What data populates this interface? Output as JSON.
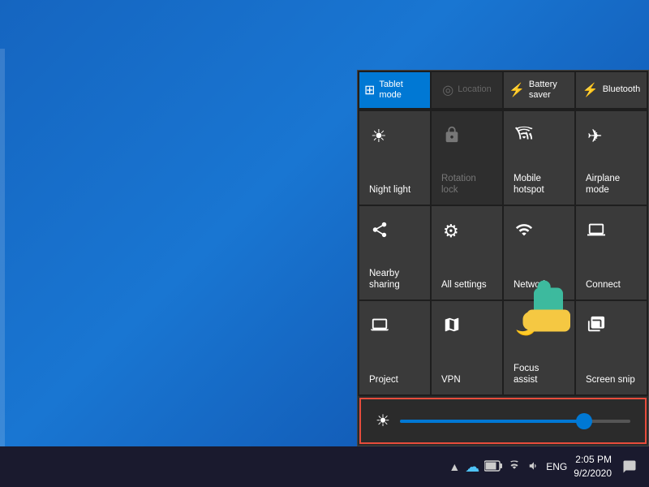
{
  "desktop": {
    "background_color": "#1565c0"
  },
  "action_center": {
    "row0": [
      {
        "id": "tablet-mode",
        "label": "Tablet mode",
        "icon": "⊞",
        "state": "active"
      },
      {
        "id": "location",
        "label": "Location",
        "icon": "📍",
        "state": "disabled"
      },
      {
        "id": "battery-saver",
        "label": "Battery saver",
        "icon": "🔋",
        "state": "normal"
      },
      {
        "id": "bluetooth",
        "label": "Bluetooth",
        "icon": "⚡",
        "state": "normal"
      }
    ],
    "row1": [
      {
        "id": "night-light",
        "label": "Night light",
        "icon": "☀",
        "state": "normal"
      },
      {
        "id": "rotation-lock",
        "label": "Rotation lock",
        "icon": "🔒",
        "state": "disabled"
      },
      {
        "id": "mobile-hotspot",
        "label": "Mobile hotspot",
        "icon": "📶",
        "state": "normal"
      },
      {
        "id": "airplane-mode",
        "label": "Airplane mode",
        "icon": "✈",
        "state": "normal"
      }
    ],
    "row2": [
      {
        "id": "nearby-sharing",
        "label": "Nearby sharing",
        "icon": "⇪",
        "state": "normal"
      },
      {
        "id": "all-settings",
        "label": "All settings",
        "icon": "⚙",
        "state": "normal"
      },
      {
        "id": "network",
        "label": "Network",
        "icon": "📡",
        "state": "normal"
      },
      {
        "id": "connect",
        "label": "Connect",
        "icon": "🖥",
        "state": "normal"
      }
    ],
    "row3": [
      {
        "id": "project",
        "label": "Project",
        "icon": "📺",
        "state": "normal"
      },
      {
        "id": "vpn",
        "label": "VPN",
        "icon": "⚭",
        "state": "normal"
      },
      {
        "id": "focus-assist",
        "label": "Focus assist",
        "icon": "🌙",
        "state": "normal"
      },
      {
        "id": "screen-snip",
        "label": "Screen snip",
        "icon": "✂",
        "state": "normal"
      }
    ]
  },
  "brightness": {
    "icon": "☀",
    "value": 80,
    "label": "Brightness"
  },
  "taskbar": {
    "time": "2:05 PM",
    "date": "9/2/2020",
    "lang": "ENG",
    "icons": [
      "▲",
      "☁",
      "🔋",
      "📶",
      "🔊"
    ]
  }
}
